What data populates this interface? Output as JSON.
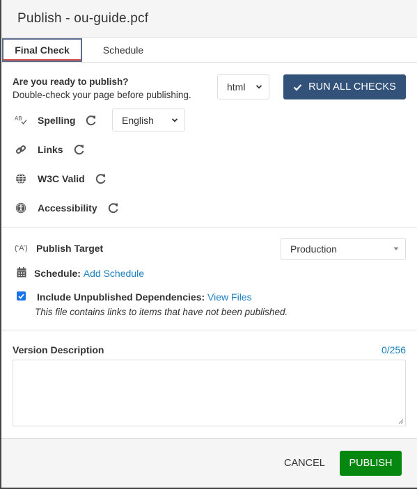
{
  "dialog": {
    "title": "Publish - ou-guide.pcf"
  },
  "tabs": [
    {
      "label": "Final Check",
      "active": true
    },
    {
      "label": "Schedule",
      "active": false
    }
  ],
  "final_check": {
    "heading": "Are you ready to publish?",
    "subheading": "Double-check your page before publishing.",
    "output_select": {
      "value": "html"
    },
    "run_all_label": "RUN ALL CHECKS",
    "checks": [
      {
        "label": "Spelling",
        "icon": "spellcheck-icon"
      },
      {
        "label": "Links",
        "icon": "link-icon"
      },
      {
        "label": "W3C Valid",
        "icon": "globe-icon"
      },
      {
        "label": "Accessibility",
        "icon": "accessibility-icon"
      }
    ],
    "language_select": {
      "value": "English"
    }
  },
  "publish_options": {
    "target_label": "Publish Target",
    "target_value": "Production",
    "schedule_label": "Schedule:",
    "schedule_link": "Add Schedule",
    "dependencies_label": "Include Unpublished Dependencies:",
    "dependencies_checked": true,
    "dependencies_link": "View Files",
    "dependencies_note": "This file contains links to items that have not been published."
  },
  "version": {
    "label": "Version Description",
    "count": "0/256",
    "value": ""
  },
  "footer": {
    "cancel_label": "CANCEL",
    "publish_label": "PUBLISH"
  },
  "colors": {
    "primary": "#33527a",
    "publish": "#06870f",
    "link": "#1a7fc1",
    "tab_underline": "#d9534f"
  }
}
